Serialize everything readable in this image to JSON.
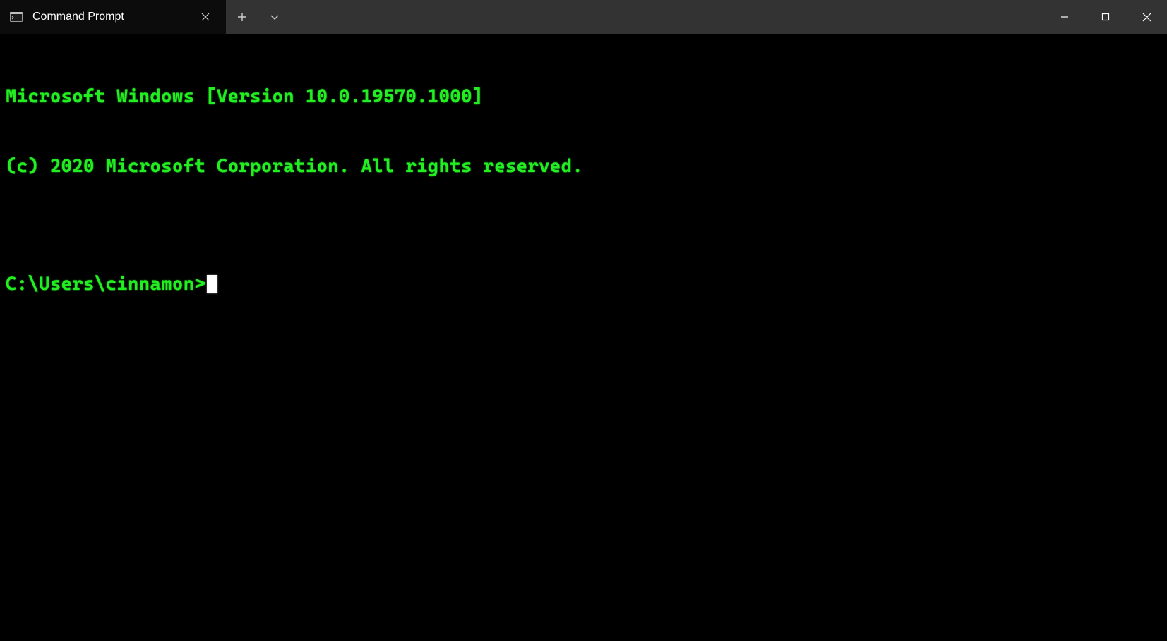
{
  "titlebar": {
    "tab": {
      "title": "Command Prompt"
    }
  },
  "terminal": {
    "lines": [
      "Microsoft Windows [Version 10.0.19570.1000]",
      "(c) 2020 Microsoft Corporation. All rights reserved.",
      ""
    ],
    "prompt": "C:\\Users\\cinnamon>",
    "input": ""
  }
}
